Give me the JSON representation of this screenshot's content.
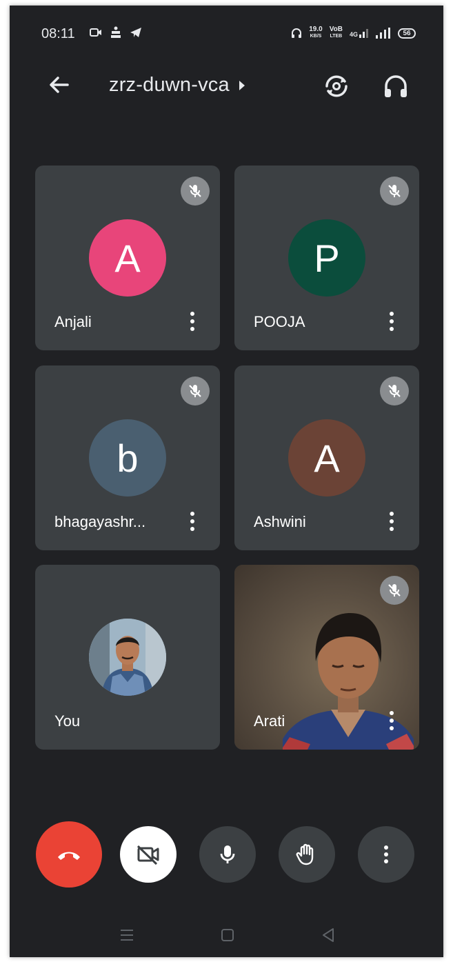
{
  "status_bar": {
    "time": "08:11",
    "speed_value": "19.0",
    "speed_unit": "KB/S",
    "volte_top": "VoB",
    "volte_bottom": "LTEB",
    "network": "4G",
    "battery": "56"
  },
  "header": {
    "meeting_code": "zrz-duwn-vca"
  },
  "participants": [
    {
      "name": "Anjali",
      "initial": "A",
      "avatar_color": "#e8457a",
      "muted": true
    },
    {
      "name": "POOJA",
      "initial": "P",
      "avatar_color": "#0b4d3c",
      "muted": true
    },
    {
      "name": "bhagayashr...",
      "initial": "b",
      "avatar_color": "#4a5f70",
      "muted": true
    },
    {
      "name": "Ashwini",
      "initial": "A",
      "avatar_color": "#6b4336",
      "muted": true
    },
    {
      "name": "You",
      "avatar": "photo-avatar",
      "muted": false
    },
    {
      "name": "Arati",
      "video": true,
      "muted": true
    }
  ],
  "controls": {
    "end_call": "phone-hangup-icon",
    "camera": "camera-off-icon",
    "mic": "mic-icon",
    "raise_hand": "hand-icon",
    "more": "more-vert-icon"
  },
  "colors": {
    "background": "#202124",
    "tile": "#3c4043",
    "end_call": "#ea4335"
  }
}
